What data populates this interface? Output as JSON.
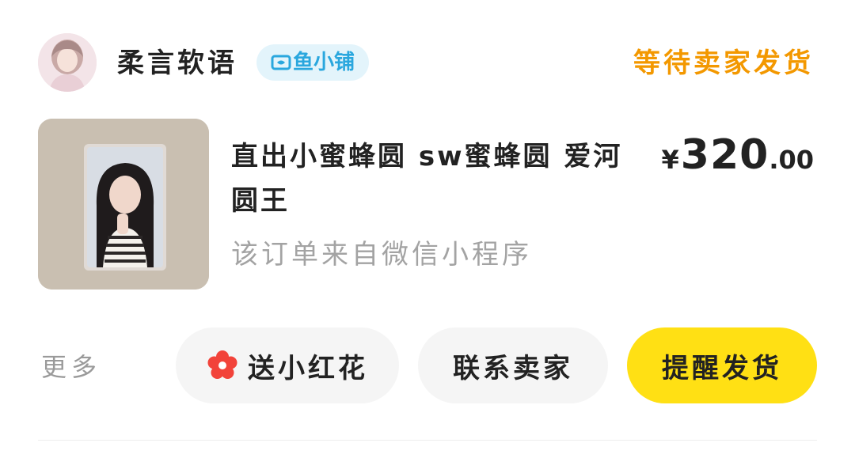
{
  "seller": {
    "name": "柔言软语",
    "shop_badge": "鱼小铺",
    "avatar_icon": "avatar-photo"
  },
  "order": {
    "status": "等待卖家发货",
    "status_color": "#f39800"
  },
  "product": {
    "title": "直出小蜜蜂圆 sw蜜蜂圆 爱河圆王",
    "price_currency": "¥",
    "price_integer": "320",
    "price_decimal": ".00",
    "source": "该订单来自微信小程序",
    "image_icon": "photocard-image"
  },
  "actions": {
    "more_label": "更多",
    "flower_label": "送小红花",
    "contact_label": "联系卖家",
    "remind_label": "提醒发货",
    "primary_color": "#ffe014"
  }
}
